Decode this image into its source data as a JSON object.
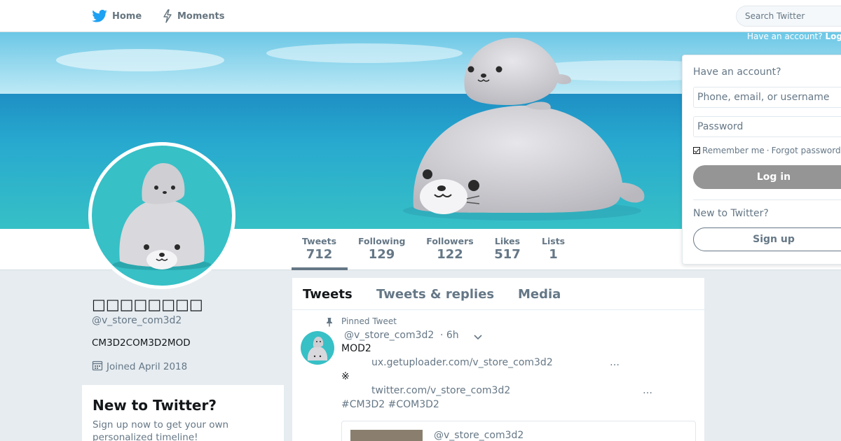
{
  "nav": {
    "home_label": "Home",
    "moments_label": "Moments",
    "search_placeholder": "Search Twitter",
    "have_account_text": "Have an account?",
    "login_link": "Log in"
  },
  "colors": {
    "twitter_blue": "#1da1f2",
    "avatar_bg": "#37c0c6",
    "muted": "#657786",
    "login_button_bg": "#959595"
  },
  "stats": [
    {
      "label": "Tweets",
      "value": "712"
    },
    {
      "label": "Following",
      "value": "129"
    },
    {
      "label": "Followers",
      "value": "122"
    },
    {
      "label": "Likes",
      "value": "517"
    },
    {
      "label": "Lists",
      "value": "1"
    }
  ],
  "profile": {
    "name": "□□□□□□□□",
    "handle": "@v_store_com3d2",
    "bio": "CM3D2COM3D2MOD",
    "joined": "Joined April 2018"
  },
  "new_to_twitter": {
    "title": "New to Twitter?",
    "subtitle": "Sign up now to get your own personalized timeline!"
  },
  "timeline": {
    "tabs": [
      "Tweets",
      "Tweets & replies",
      "Media"
    ],
    "pinned_label": "Pinned Tweet",
    "tweet": {
      "handle": "@v_store_com3d2",
      "time": "· 6h",
      "line1": "MOD2",
      "link1": "ux.getuploader.com/v_store_com3d2",
      "ellipsis1": "…",
      "line2": "※",
      "link2": "twitter.com/v_store_com3d2",
      "ellipsis2": "…",
      "hashtags": "#CM3D2 #COM3D2",
      "card_handle": "@v_store_com3d2"
    }
  },
  "login_panel": {
    "title": "Have an account?",
    "phone_placeholder": "Phone, email, or username",
    "password_placeholder": "Password",
    "remember_me": "Remember me",
    "separator": "·",
    "forgot_password": "Forgot password?",
    "login_button": "Log in",
    "new_to_twitter": "New to Twitter?",
    "signup_button": "Sign up"
  }
}
